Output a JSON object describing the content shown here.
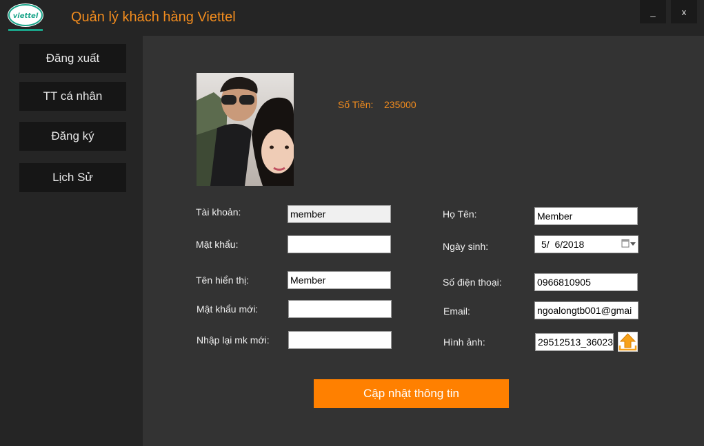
{
  "app": {
    "title": "Quản lý khách hàng Viettel",
    "logo_text": "viettel",
    "minimize": "_",
    "close": "x"
  },
  "sidebar": {
    "items": [
      {
        "label": "Đăng xuất"
      },
      {
        "label": "TT cá nhân"
      },
      {
        "label": "Đăng ký"
      },
      {
        "label": "Lịch Sử"
      }
    ]
  },
  "profile": {
    "money_label": "Số Tiền:",
    "money_value": "235000"
  },
  "form": {
    "username_label": "Tài khoản:",
    "username_value": "member",
    "password_label": "Mật khẩu:",
    "password_value": "",
    "display_name_label": "Tên hiển thị:",
    "display_name_value": "Member",
    "new_password_label": "Mật khẩu mới:",
    "new_password_value": "",
    "confirm_password_label": "Nhập lại mk mới:",
    "confirm_password_value": "",
    "fullname_label": "Họ Tên:",
    "fullname_value": "Member",
    "birthday_label": "Ngày sinh:",
    "birthday_value": "5/  6/2018",
    "phone_label": "Số điện thoại:",
    "phone_value": "0966810905",
    "email_label": "Email:",
    "email_value": "ngoalongtb001@gmai",
    "image_label": "Hình ảnh:",
    "image_value": "29512513_36023",
    "submit_label": "Cập nhật thông tin"
  },
  "colors": {
    "accent": "#ff8000",
    "title": "#f28c1e",
    "background": "#252525",
    "panel": "#333333"
  },
  "icons": {
    "calendar": "calendar-icon",
    "upload": "upload-arrow-icon"
  }
}
